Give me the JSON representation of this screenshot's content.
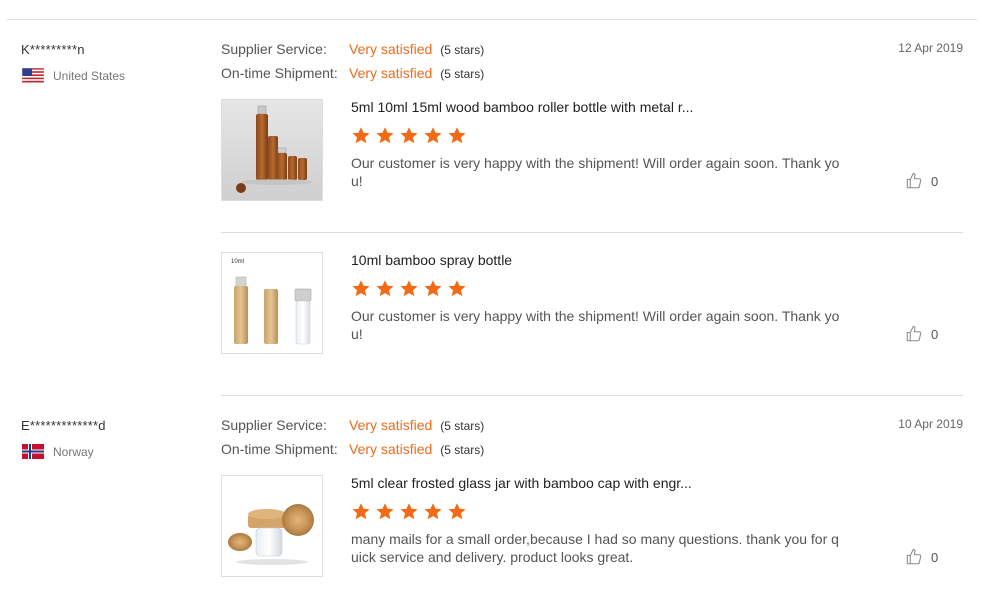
{
  "reviews": [
    {
      "buyer": "K*********n",
      "country": "United States",
      "flag_icon": "us-flag-icon",
      "date": "12 Apr 2019",
      "supplier_service": {
        "label": "Supplier Service:",
        "value": "Very satisfied",
        "stars": "(5 stars)"
      },
      "shipment": {
        "label": "On-time Shipment:",
        "value": "Very satisfied",
        "stars": "(5 stars)"
      },
      "products": [
        {
          "title": "5ml 10ml 15ml wood bamboo roller bottle with metal r...",
          "rating": 5,
          "text": "Our customer is very happy with the shipment! Will order again soon. Thank you!",
          "likes": "0"
        },
        {
          "title": "10ml bamboo spray bottle",
          "rating": 5,
          "text": "Our customer is very happy with the shipment! Will order again soon. Thank you!",
          "likes": "0",
          "thumb_label": "10ml"
        }
      ]
    },
    {
      "buyer": "E*************d",
      "country": "Norway",
      "flag_icon": "norway-flag-icon",
      "date": "10 Apr 2019",
      "supplier_service": {
        "label": "Supplier Service:",
        "value": "Very satisfied",
        "stars": "(5 stars)"
      },
      "shipment": {
        "label": "On-time Shipment:",
        "value": "Very satisfied",
        "stars": "(5 stars)"
      },
      "products": [
        {
          "title": "5ml clear frosted glass jar with bamboo cap with engr...",
          "rating": 5,
          "text": "many mails for a small order,because I had so many questions. thank you for quick service and delivery. product looks great.",
          "likes": "0"
        }
      ]
    }
  ],
  "colors": {
    "accent": "#ef6c1a",
    "star": "#f26a16",
    "divider": "#dddddd"
  },
  "icons": {
    "star": "star-icon",
    "like": "thumbs-up-icon"
  }
}
